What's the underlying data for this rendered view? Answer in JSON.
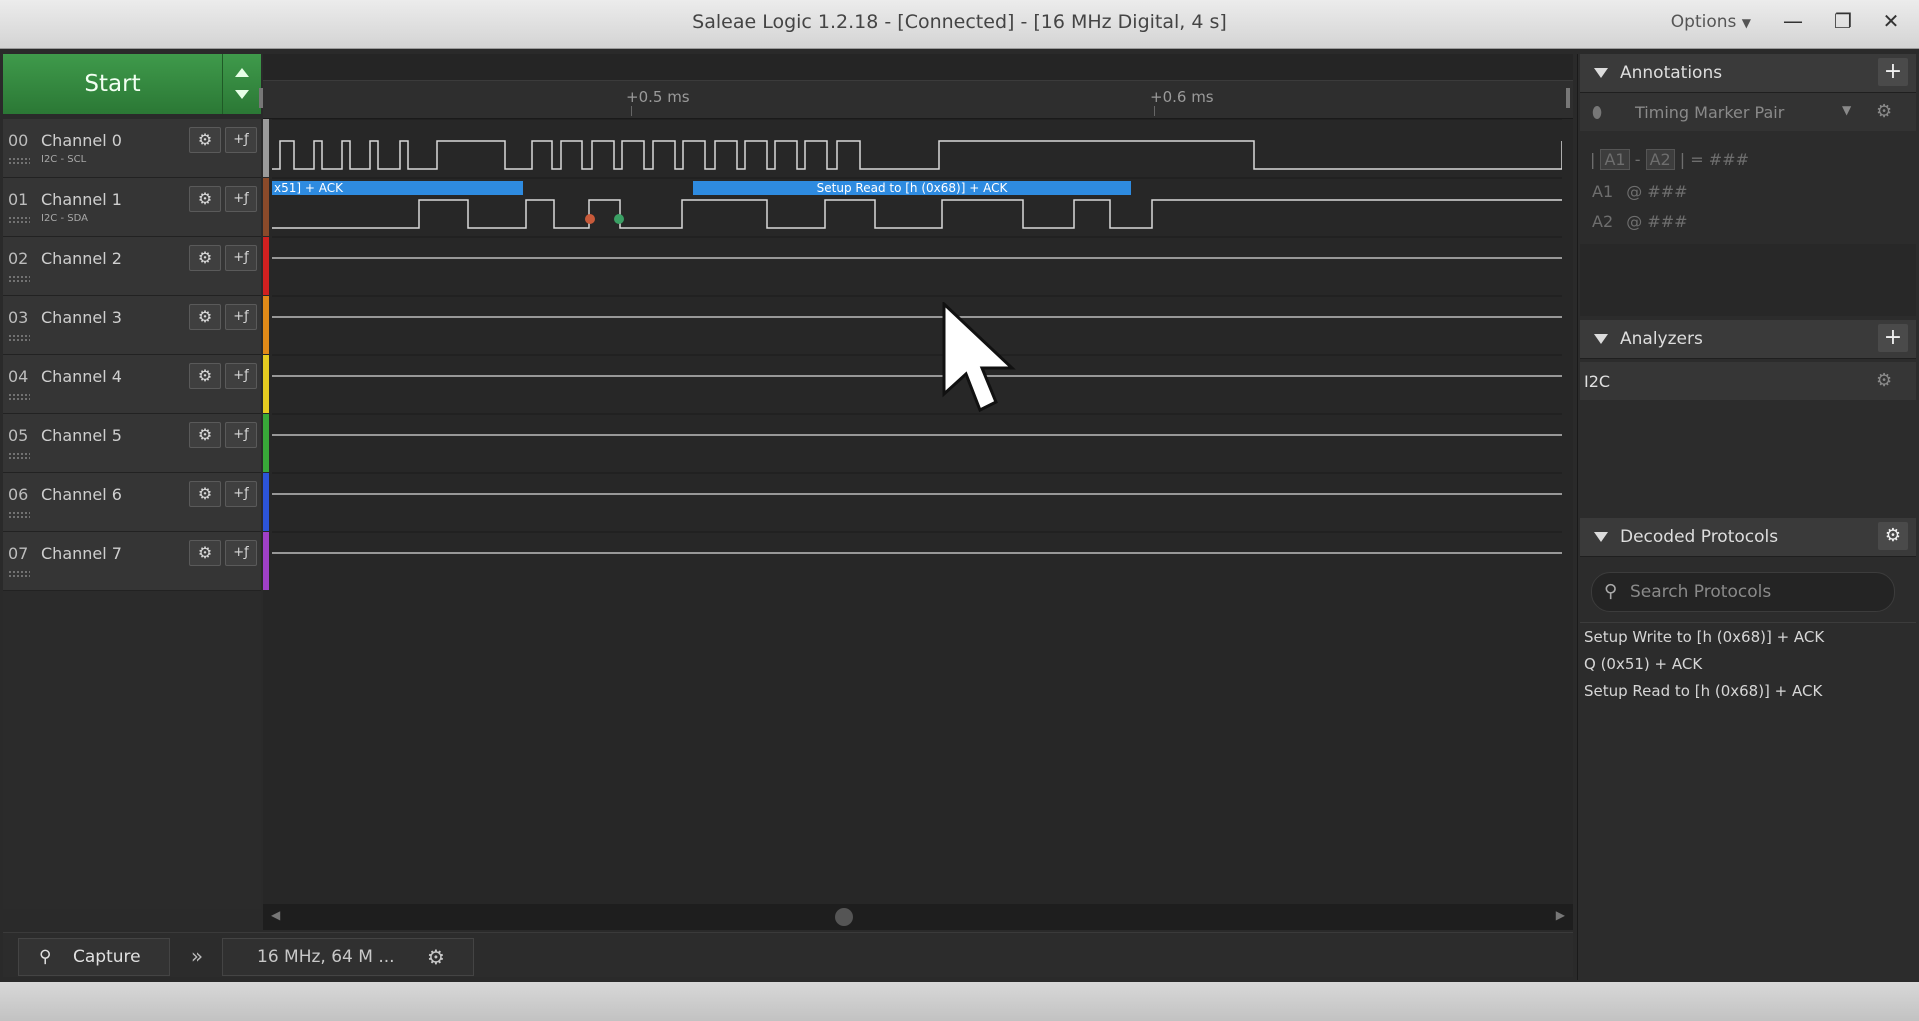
{
  "window": {
    "title": "Saleae Logic 1.2.18 - [Connected] - [16 MHz Digital, 4 s]",
    "options_label": "Options",
    "minimize_glyph": "—",
    "restore_glyph": "❐",
    "close_glyph": "✕"
  },
  "start": {
    "label": "Start"
  },
  "ruler": {
    "tick1": "+0.5 ms",
    "tick2": "+0.6 ms"
  },
  "channels": [
    {
      "num": "00",
      "name": "Channel 0",
      "sub": "I2C - SCL",
      "color": "#9a9a9a"
    },
    {
      "num": "01",
      "name": "Channel 1",
      "sub": "I2C - SDA",
      "color": "#8a4a2a"
    },
    {
      "num": "02",
      "name": "Channel 2",
      "sub": "",
      "color": "#d02020"
    },
    {
      "num": "03",
      "name": "Channel 3",
      "sub": "",
      "color": "#e08a18"
    },
    {
      "num": "04",
      "name": "Channel 4",
      "sub": "",
      "color": "#e6cc20"
    },
    {
      "num": "05",
      "name": "Channel 5",
      "sub": "",
      "color": "#38a838"
    },
    {
      "num": "06",
      "name": "Channel 6",
      "sub": "",
      "color": "#2c54d8"
    },
    {
      "num": "07",
      "name": "Channel 7",
      "sub": "",
      "color": "#a040c8"
    }
  ],
  "channel_buttons": {
    "settings_glyph": "⚙",
    "trigger_glyph": "+ƒ"
  },
  "decode_bubbles": [
    {
      "label": "x51] + ACK",
      "color": "#2e8be0"
    },
    {
      "label": "Setup Read to [h (0x68)] + ACK",
      "color": "#2e8be0"
    }
  ],
  "bottom": {
    "capture_label": "Capture",
    "expand_glyph": "»",
    "rate_label": "16 MHz, 64 M ...",
    "settings_glyph": "⚙"
  },
  "annotations": {
    "title": "Annotations",
    "add_glyph": "+",
    "marker_type": "Timing Marker Pair",
    "formula_a1": "A1",
    "formula_a2": "A2",
    "formula_value": "= ###",
    "a1_label": "A1",
    "a1_value": "@ ###",
    "a2_label": "A2",
    "a2_value": "@ ###"
  },
  "analyzers": {
    "title": "Analyzers",
    "add_glyph": "+",
    "items": [
      {
        "label": "I2C"
      }
    ]
  },
  "decoded": {
    "title": "Decoded Protocols",
    "search_placeholder": "Search Protocols",
    "items": [
      "Setup Write to [h (0x68)] + ACK",
      "Q (0x51) + ACK",
      "Setup Read to [h (0x68)] + ACK"
    ]
  },
  "colors": {
    "accent_green": "#2f8a3b",
    "decode_blue": "#2e8be0",
    "waveform": "#d8d8d8"
  }
}
